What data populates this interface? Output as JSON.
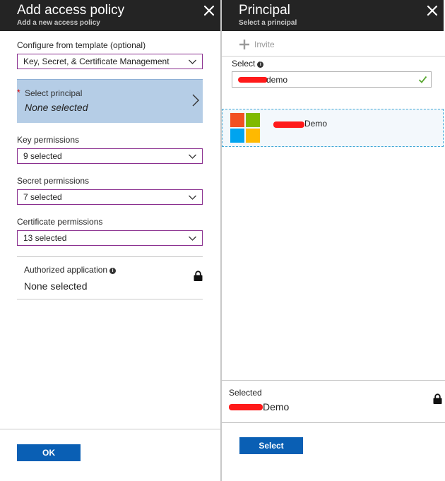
{
  "left_blade": {
    "title": "Add access policy",
    "subtitle": "Add a new access policy",
    "close_icon": "close-icon",
    "template": {
      "label": "Configure from template (optional)",
      "value": "Key, Secret, & Certificate Management"
    },
    "principal": {
      "required_marker": "*",
      "label": "Select principal",
      "value": "None selected"
    },
    "key_permissions": {
      "label": "Key permissions",
      "value": "9 selected"
    },
    "secret_permissions": {
      "label": "Secret permissions",
      "value": "7 selected"
    },
    "certificate_permissions": {
      "label": "Certificate permissions",
      "value": "13 selected"
    },
    "authorized_application": {
      "label": "Authorized application",
      "info_glyph": "i",
      "value": "None selected"
    },
    "ok_label": "OK"
  },
  "right_blade": {
    "title": "Principal",
    "subtitle": "Select a principal",
    "invite_label": "Invite",
    "select_label": "Select",
    "info_glyph": "i",
    "search_value": "demo",
    "result": {
      "name": "Demo"
    },
    "selected_label": "Selected",
    "selected_value": "Demo",
    "select_button_label": "Select"
  },
  "colors": {
    "header_bg": "#242424",
    "accent_blue": "#0a5fb4",
    "dropdown_border": "#8a2f8f",
    "picker_bg": "#b5cde6",
    "redaction": "#ff1a1a",
    "success_check": "#5aa832"
  }
}
